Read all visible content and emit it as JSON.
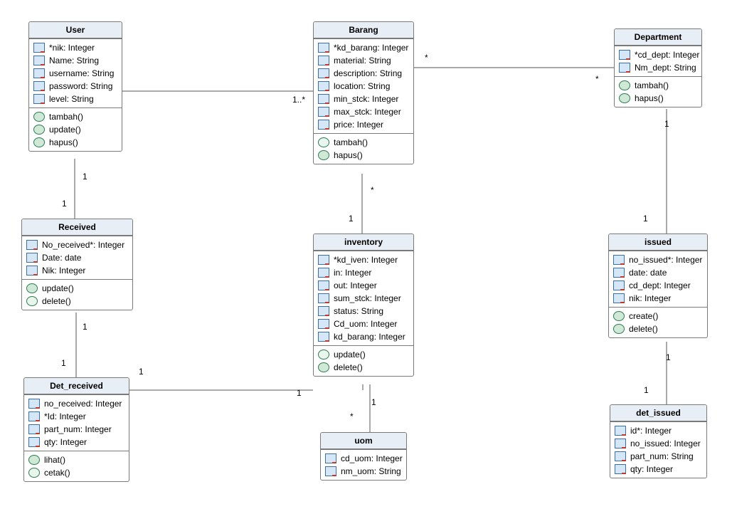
{
  "classes": {
    "user": {
      "title": "User",
      "attrs": [
        "*nik: Integer",
        "Name: String",
        "username: String",
        "password: String",
        "level: String"
      ],
      "meths": [
        "tambah()",
        "update()",
        "hapus()"
      ]
    },
    "barang": {
      "title": "Barang",
      "attrs": [
        "*kd_barang: Integer",
        "material: String",
        "description: String",
        "location: String",
        "min_stck: Integer",
        "max_stck: Integer",
        "price: Integer"
      ],
      "meths": [
        "tambah()",
        "hapus()"
      ]
    },
    "department": {
      "title": "Department",
      "attrs": [
        "*cd_dept: Integer",
        "Nm_dept: String"
      ],
      "meths": [
        "tambah()",
        "hapus()"
      ]
    },
    "received": {
      "title": "Received",
      "attrs": [
        "No_received*: Integer",
        "Date: date",
        "Nik: Integer"
      ],
      "meths": [
        "update()",
        "delete()"
      ]
    },
    "inventory": {
      "title": "inventory",
      "attrs": [
        "*kd_iven: Integer",
        "in: Integer",
        "out: Integer",
        "sum_stck: Integer",
        "status: String",
        "Cd_uom: Integer",
        "kd_barang: Integer"
      ],
      "meths": [
        "update()",
        "delete()"
      ]
    },
    "issued": {
      "title": "issued",
      "attrs": [
        "no_issued*: Integer",
        "date: date",
        "cd_dept: Integer",
        "nik: Integer"
      ],
      "meths": [
        "create()",
        "delete()"
      ]
    },
    "det_received": {
      "title": "Det_received",
      "attrs": [
        "no_received: Integer",
        "*Id: Integer",
        "part_num: Integer",
        "qty: Integer"
      ],
      "meths": [
        "lihat()",
        "cetak()"
      ]
    },
    "uom": {
      "title": "uom",
      "attrs": [
        "cd_uom: Integer",
        "nm_uom: String"
      ],
      "meths": []
    },
    "det_issued": {
      "title": "det_issued",
      "attrs": [
        "id*: Integer",
        "no_issued: Integer",
        "part_num: String",
        "qty: Integer"
      ],
      "meths": []
    }
  },
  "mult": {
    "m1": "1",
    "m2": "1",
    "m3": "1..*",
    "m4": "*",
    "m5": "*",
    "m6": "1",
    "m7": "1",
    "m8": "1",
    "m9": "1",
    "m10": "1",
    "m11": "1",
    "m12": "*",
    "m13": "1",
    "m14": "1",
    "m15": "1",
    "m16": "1"
  }
}
